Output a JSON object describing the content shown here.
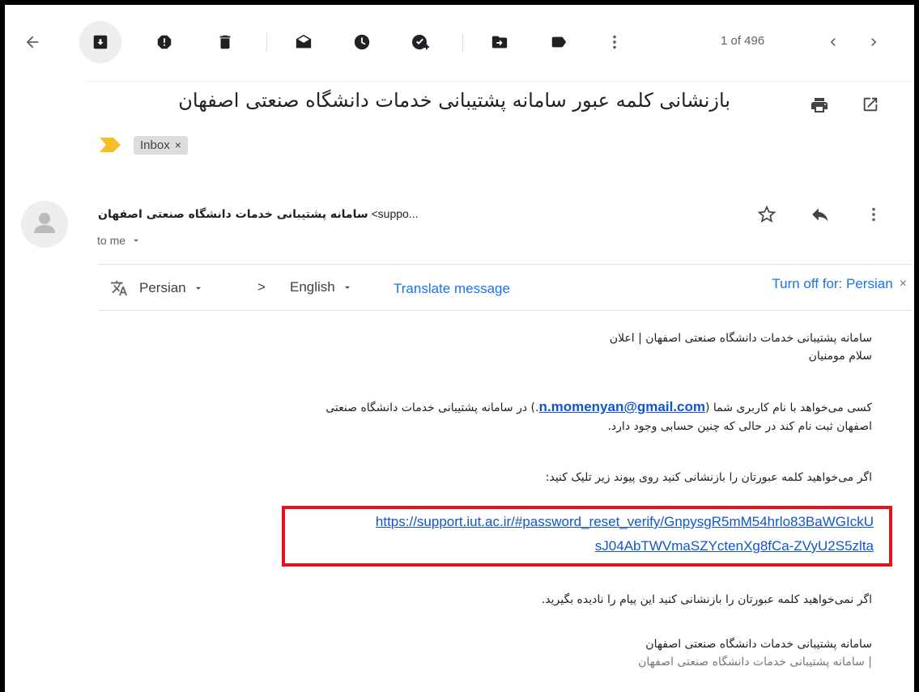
{
  "toolbar": {
    "items": [
      {
        "name": "back-arrow-icon"
      },
      {
        "name": "archive-icon"
      },
      {
        "name": "report-spam-icon"
      },
      {
        "name": "delete-icon"
      },
      {
        "name": "mark-unread-icon"
      },
      {
        "name": "snooze-icon"
      },
      {
        "name": "add-task-icon"
      },
      {
        "name": "move-to-icon"
      },
      {
        "name": "label-icon"
      },
      {
        "name": "more-vert-icon"
      }
    ],
    "pager": "1 of 496",
    "prev_icon": "chevron-left-icon",
    "next_icon": "chevron-right-icon"
  },
  "subject": "بازنشانی کلمه عبور سامانه پشتیبانی خدمات دانشگاه صنعتی اصفهان",
  "subject_icons": [
    "print-icon",
    "open-in-new-icon"
  ],
  "labels": {
    "importance_marker_color": "#f6bf26",
    "chip": "Inbox",
    "chip_remove": "×"
  },
  "message": {
    "sender_name": "سامانه پشتیبانی خدمات دانشگاه صنعتی اصفهان",
    "sender_email_fragment": "<suppo...",
    "to": "to me",
    "actions": [
      "star-icon",
      "reply-icon",
      "more-vert-icon"
    ]
  },
  "translate": {
    "source_lang": "Persian",
    "arrow": ">",
    "target_lang": "English",
    "translate_link": "Translate message",
    "turn_off": "Turn off for: Persian",
    "close": "×"
  },
  "body": {
    "line1": "سامانه پشتیبانی خدمات دانشگاه صنعتی اصفهان | اعلان",
    "line2": "سلام مومنیان",
    "para1_before": "کسی می‌خواهد با نام کاربری شما (",
    "email": "n.momenyan@gmail.com",
    "para1_after": ".) در سامانه پشتیبانی خدمات دانشگاه صنعتی",
    "para1_line2": "اصفهان ثبت نام کند در حالی که چنین حسابی وجود دارد.",
    "para2": "اگر می‌خواهید کلمه عبورتان را بازنشانی کنید روی پیوند زیر تلیک کنید:",
    "reset_link_line1": "https://support.iut.ac.ir/#password_reset_verify/GnpysgR5mM54hrlo83BaWGIckU",
    "reset_link_line2": "sJ04AbTWVmaSZYctenXg8fCa-ZVyU2S5zlta",
    "para3": "اگر نمی‌خواهید کلمه عبورتان را بازنشانی کنید این پیام را نادیده بگیرید.",
    "sig1": "سامانه پشتیبانی خدمات دانشگاه صنعتی اصفهان",
    "sig2": "| سامانه پشتیبانی خدمات دانشگاه صنعتی اصفهان"
  },
  "colors": {
    "highlight_box": "#e3141f",
    "link": "#1155cc",
    "accent": "#1a73e8"
  }
}
